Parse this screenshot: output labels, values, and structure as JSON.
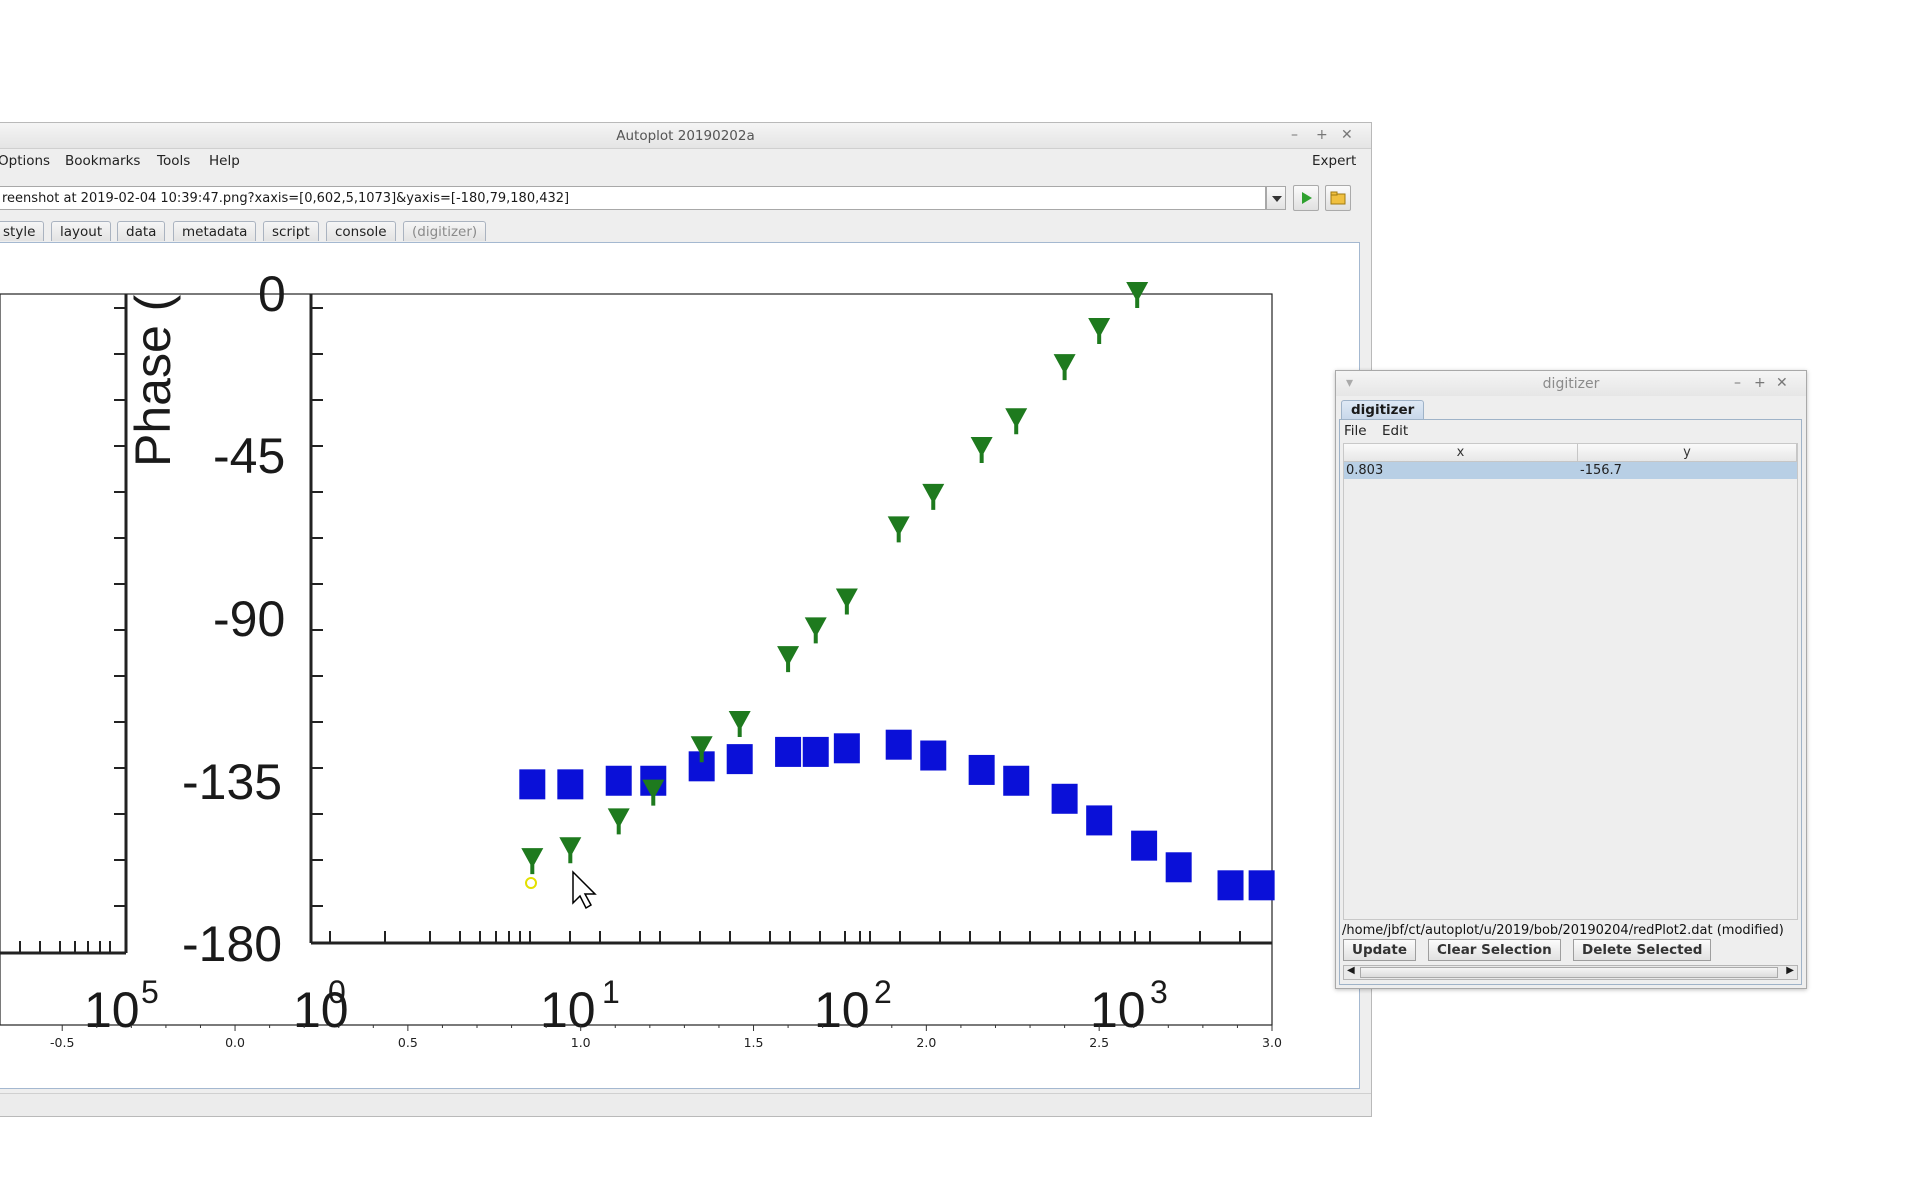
{
  "main_window": {
    "title": "Autoplot 20190202a",
    "menu": [
      "Options",
      "Bookmarks",
      "Tools",
      "Help"
    ],
    "expert_label": "Expert",
    "url_value": "reenshot at 2019-02-04 10:39:47.png?xaxis=[0,602,5,1073]&yaxis=[-180,79,180,432]",
    "tabs": [
      "style",
      "layout",
      "data",
      "metadata",
      "script",
      "console",
      "(digitizer)"
    ]
  },
  "plot": {
    "image_labels": {
      "ylabel": "Phase (",
      "y_ticks": [
        "0",
        "-45",
        "-90",
        "-135",
        "-180"
      ],
      "x_ticks": [
        "10",
        "10",
        "10",
        "10"
      ],
      "x_exponents": [
        "0",
        "1",
        "2",
        "3"
      ],
      "left_partial_tick": "10",
      "left_partial_exp": "5"
    },
    "colors": {
      "blue_series": "#0a10d8",
      "green_series": "#1e7a1e"
    }
  },
  "chart_data": {
    "type": "scatter",
    "x_axis": {
      "ticks": [
        "-0.5",
        "0.0",
        "0.5",
        "1.0",
        "1.5",
        "2.0",
        "2.5",
        "3.0"
      ],
      "range": [
        -0.68,
        3.0
      ]
    },
    "series": [
      {
        "points": [
          [
            0.86,
            -136
          ],
          [
            0.97,
            -136
          ],
          [
            1.11,
            -135
          ],
          [
            1.21,
            -135
          ],
          [
            1.35,
            -131
          ],
          [
            1.46,
            -129
          ],
          [
            1.6,
            -127
          ],
          [
            1.68,
            -127
          ],
          [
            1.77,
            -126
          ],
          [
            1.92,
            -125
          ],
          [
            2.02,
            -128
          ],
          [
            2.16,
            -132
          ],
          [
            2.26,
            -135
          ],
          [
            2.4,
            -140
          ],
          [
            2.5,
            -146
          ],
          [
            2.63,
            -153
          ],
          [
            2.73,
            -159
          ],
          [
            2.88,
            -164
          ],
          [
            2.97,
            -164
          ]
        ]
      },
      {
        "points": [
          [
            0.86,
            -157
          ],
          [
            0.97,
            -154
          ],
          [
            1.11,
            -146
          ],
          [
            1.21,
            -138
          ],
          [
            1.35,
            -126
          ],
          [
            1.46,
            -119
          ],
          [
            1.6,
            -101
          ],
          [
            1.68,
            -93
          ],
          [
            1.77,
            -85
          ],
          [
            1.92,
            -65
          ],
          [
            2.02,
            -56
          ],
          [
            2.16,
            -43
          ],
          [
            2.26,
            -35
          ],
          [
            2.4,
            -20
          ],
          [
            2.5,
            -10
          ],
          [
            2.61,
            0
          ]
        ]
      }
    ]
  },
  "digitizer": {
    "title": "digitizer",
    "tab_label": "digitizer",
    "menu": [
      "File",
      "Edit"
    ],
    "columns": [
      "x",
      "y"
    ],
    "rows": [
      [
        "0.803",
        "-156.7"
      ]
    ],
    "filename": "/home/jbf/ct/autoplot/u/2019/bob/20190204/redPlot2.dat (modified)",
    "buttons": [
      "Update",
      "Clear Selection",
      "Delete Selected"
    ]
  }
}
